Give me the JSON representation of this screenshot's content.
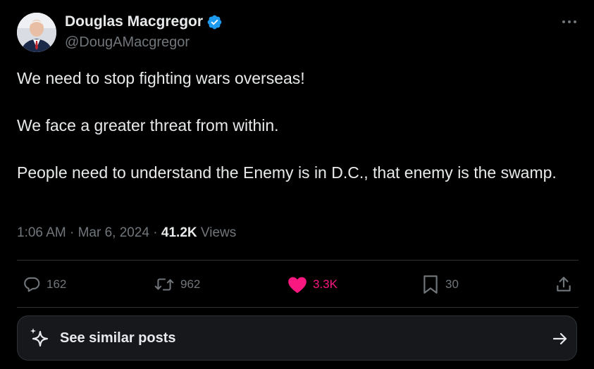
{
  "author": {
    "name": "Douglas Macgregor",
    "handle": "@DougAMacgregor",
    "verified": true
  },
  "tweet": {
    "paragraphs": [
      "We need to stop fighting wars overseas!",
      "We face a greater threat from within.",
      "People need to understand the Enemy is in D.C., that enemy is the swamp."
    ],
    "time": "1:06 AM",
    "date": "Mar 6, 2024",
    "views_count": "41.2K",
    "views_label": "Views"
  },
  "actions": {
    "replies": "162",
    "reposts": "962",
    "likes": "3.3K",
    "bookmarks": "30"
  },
  "similar": {
    "label": "See similar posts"
  },
  "colors": {
    "background": "#000000",
    "text": "#e7e9ea",
    "muted": "#71767b",
    "like": "#f91880",
    "verified": "#1d9bf0",
    "divider": "#2f3336"
  },
  "icons": [
    "more-icon",
    "verified-badge-icon",
    "reply-icon",
    "repost-icon",
    "heart-icon",
    "bookmark-icon",
    "share-icon",
    "sparkle-icon",
    "arrow-right-icon"
  ]
}
